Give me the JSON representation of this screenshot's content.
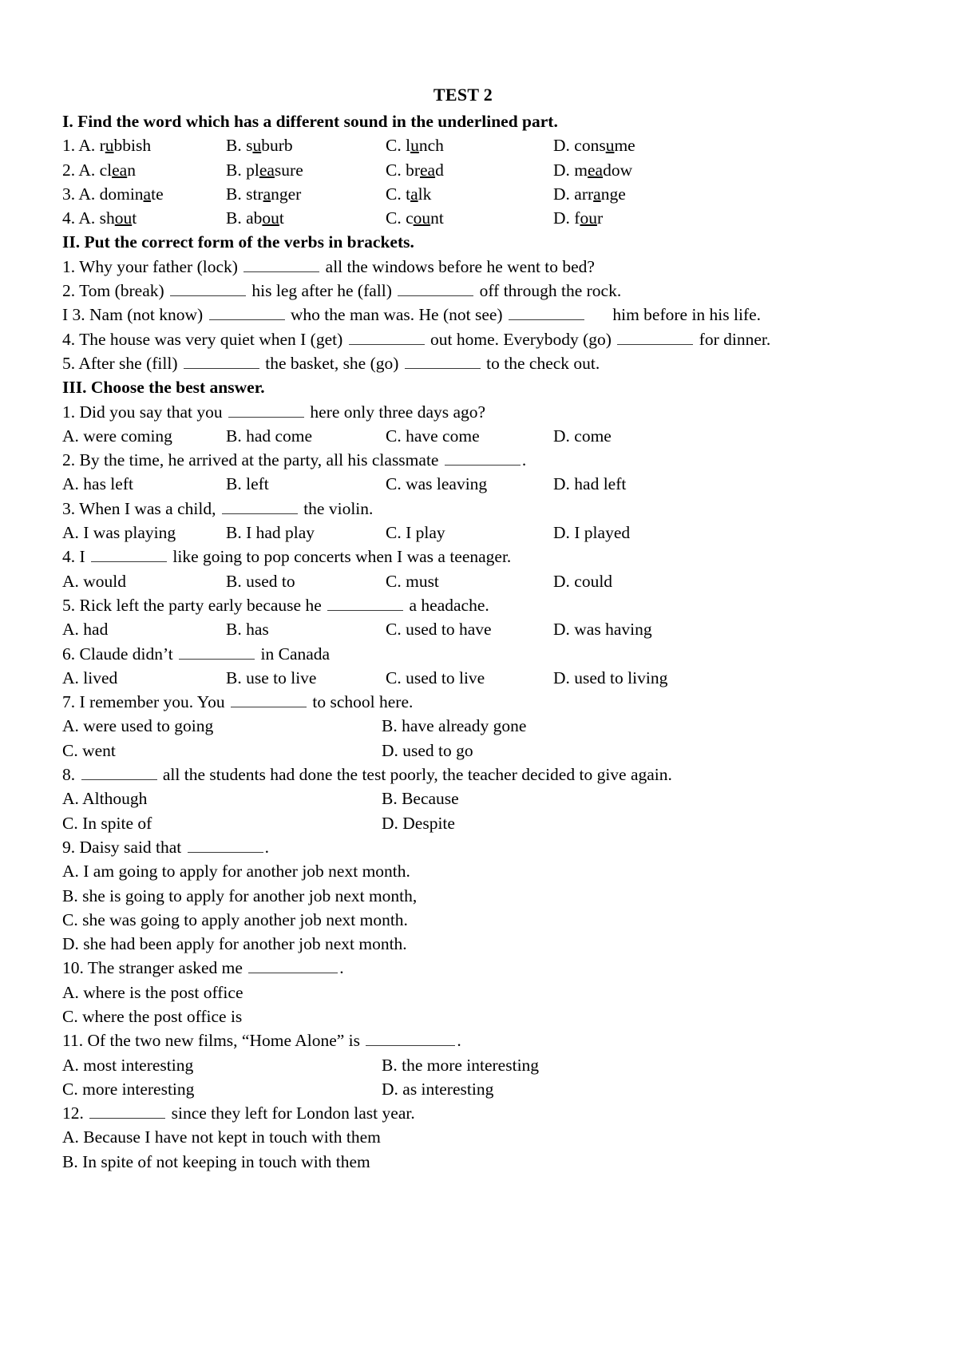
{
  "document": {
    "title": "TEST 2"
  },
  "sections": [
    {
      "id": "section-1",
      "heading": "I. Find the word which has a different sound in the underlined part.",
      "rows": [
        {
          "a": "1. A. r",
          "a_u": "u",
          "a_t": "bbish",
          "b": "B. s",
          "b_u": "u",
          "b_t": "burb",
          "c": "C. l",
          "c_u": "u",
          "c_t": "nch",
          "d": "D. cons",
          "d_u": "u",
          "d_t": "me"
        },
        {
          "a": "2. A. cl",
          "a_u": "ea",
          "a_t": "n",
          "b": "B. pl",
          "b_u": "ea",
          "b_t": "sure",
          "c": "C. br",
          "c_u": "ea",
          "c_t": "d",
          "d": "D. m",
          "d_u": "ea",
          "d_t": "dow"
        },
        {
          "a": "3. A. domin",
          "a_u": "a",
          "a_t": "te",
          "b": "B. str",
          "b_u": "a",
          "b_t": "nger",
          "c": "C. t",
          "c_u": "a",
          "c_t": "lk",
          "d": "D. arr",
          "d_u": "a",
          "d_t": "nge"
        },
        {
          "a": "4. A. sh",
          "a_u": "ou",
          "a_t": "t",
          "b": "B. ab",
          "b_u": "ou",
          "b_t": "t",
          "c": "C. c",
          "c_u": "ou",
          "c_t": "nt",
          "d": "D. f",
          "d_u": "ou",
          "d_t": "r"
        }
      ]
    },
    {
      "id": "section-2",
      "heading": "II. Put the correct form of the verbs in brackets.",
      "items": [
        {
          "p1": "1. Why your father (lock)",
          "p2": "all the windows before he went to bed?"
        },
        {
          "p1": "2. Tom (break)",
          "p2": "his leg after he (fall)",
          "p3": "off through the rock."
        },
        {
          "p1": "I 3. Nam (not know)",
          "p2": "who the man was. He (not see)",
          "p3": "him before in his life."
        },
        {
          "p1": "4. The house was very quiet when I (get)",
          "p2": "out home. Everybody (go)",
          "p3": "for dinner."
        },
        {
          "p1": "5. After she (fill)",
          "p2": "the basket, she (go)",
          "p3": "to the check out."
        }
      ]
    },
    {
      "id": "section-3",
      "heading": "III. Choose the best answer.",
      "questions": [
        {
          "stem_pre": "1. Did you say that you",
          "stem_post": "here only three days ago?",
          "layout": "cols4",
          "options": [
            "A. were coming",
            "B. had come",
            "C. have come",
            "D. come"
          ]
        },
        {
          "stem_pre": "2. By the time, he arrived at the party, all his classmate",
          "stem_post": ".",
          "layout": "cols4",
          "options": [
            "A. has left",
            "B. left",
            "C. was leaving",
            "D. had left"
          ]
        },
        {
          "stem_pre": "3. When I was a child,",
          "stem_post": "the violin.",
          "layout": "cols4",
          "options": [
            "A. I was playing",
            "B. I had play",
            "C. I play",
            "D. I played"
          ]
        },
        {
          "stem_pre": "4. I",
          "stem_post": "like going to pop concerts when I was a teenager.",
          "layout": "cols4",
          "options": [
            "A. would",
            "B. used to",
            "C. must",
            "D. could"
          ]
        },
        {
          "stem_pre": "5. Rick left the party early because he",
          "stem_post": "a headache.",
          "layout": "cols4",
          "options": [
            "A. had",
            "B. has",
            "C. used to have",
            "D. was having"
          ]
        },
        {
          "stem_pre": "6. Claude didn’t",
          "stem_post": "in Canada",
          "layout": "cols4",
          "options": [
            "A. lived",
            "B. use to live",
            "C. used to live",
            "D. used to living"
          ]
        },
        {
          "stem_pre": "7. I remember you. You",
          "stem_post": "to school here.",
          "layout": "cols2",
          "options": [
            "A. were used to going",
            "B. have already gone",
            "C. went",
            "D. used to go"
          ]
        },
        {
          "stem_pre": "8.",
          "stem_post": "all the students had done the test poorly, the teacher decided to give again.",
          "layout": "cols2",
          "options": [
            "A. Although",
            "B. Because",
            "C. In spite of",
            "D. Despite"
          ]
        },
        {
          "stem_pre": "9. Daisy said that",
          "stem_post": ".",
          "layout": "stacked",
          "options": [
            "A. I am going to apply for another job next month.",
            "B. she is going to apply for another job next month,",
            "C. she was going to apply another job next month.",
            "D. she had been apply for another job next month."
          ]
        },
        {
          "stem_pre": "10. The stranger asked me",
          "stem_post": ".",
          "layout": "stacked",
          "options": [
            "A. where is the post office",
            "C. where the post office is"
          ]
        },
        {
          "stem_pre": "11. Of the two new films, “Home Alone” is",
          "stem_post": ".",
          "layout": "cols2",
          "options": [
            "A. most interesting",
            "B. the more interesting",
            "C. more interesting",
            "D. as interesting"
          ]
        },
        {
          "stem_pre": "12.",
          "stem_post": "since they left for London last year.",
          "layout": "stacked",
          "options": [
            "A. Because I have not kept in touch with them",
            "B. In spite of not keeping in touch with them"
          ]
        }
      ]
    }
  ]
}
